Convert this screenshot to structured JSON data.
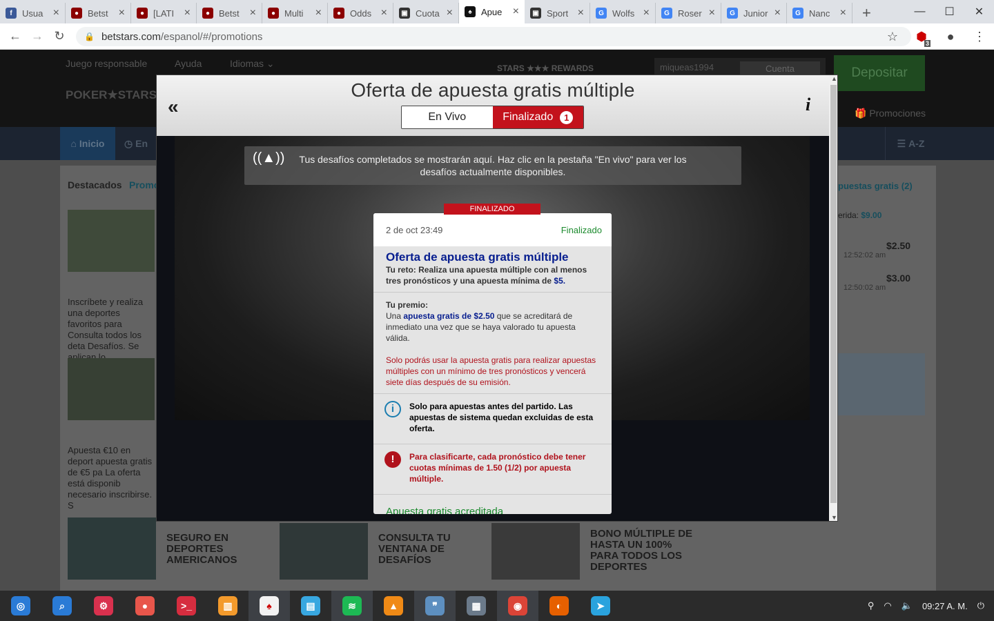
{
  "browser": {
    "tabs": [
      {
        "title": "Usua",
        "icon": "facebook-icon",
        "color": "#3b5998",
        "glyph": "f"
      },
      {
        "title": "Betst",
        "icon": "betstars-icon",
        "color": "#8b0000",
        "glyph": "●"
      },
      {
        "title": "[LATI",
        "icon": "betstars-icon",
        "color": "#8b0000",
        "glyph": "●"
      },
      {
        "title": "Betst",
        "icon": "betstars-icon",
        "color": "#8b0000",
        "glyph": "●"
      },
      {
        "title": "Multi",
        "icon": "betstars-icon",
        "color": "#8b0000",
        "glyph": "●"
      },
      {
        "title": "Odds",
        "icon": "betstars-icon",
        "color": "#8b0000",
        "glyph": "●"
      },
      {
        "title": "Cuota",
        "icon": "chart-icon",
        "color": "#333333",
        "glyph": "▣"
      },
      {
        "title": "Apue",
        "icon": "pokerstars-icon",
        "color": "#111111",
        "glyph": "♠",
        "active": true
      },
      {
        "title": "Sport",
        "icon": "chart-icon",
        "color": "#333333",
        "glyph": "▣"
      },
      {
        "title": "Wolfs",
        "icon": "google-icon",
        "color": "#4285f4",
        "glyph": "G"
      },
      {
        "title": "Roser",
        "icon": "google-icon",
        "color": "#4285f4",
        "glyph": "G"
      },
      {
        "title": "Junior",
        "icon": "google-icon",
        "color": "#4285f4",
        "glyph": "G"
      },
      {
        "title": "Nanc",
        "icon": "google-icon",
        "color": "#4285f4",
        "glyph": "G"
      }
    ],
    "url_host": "betstars.com",
    "url_path": "/espanol/#/promotions",
    "ext_badge": "3"
  },
  "site": {
    "top_links": [
      "Juego responsable",
      "Ayuda",
      "Idiomas ⌄"
    ],
    "logo": "POKER★STARS",
    "rewards": "STARS ★★★ REWARDS",
    "username": "miqueas1994",
    "cuenta": "Cuenta",
    "deposit": "Depositar",
    "promos": "Promociones",
    "nav_inicio": "Inicio",
    "nav_envivo": "En",
    "nav_az": "A-Z",
    "tab_destacados": "Destacados",
    "tab_promos": "Promo",
    "right_tab": "puestas gratis",
    "right_tab_count": "(2)",
    "right_req_label": "erida:",
    "right_req_value": "$9.00",
    "right_items": [
      {
        "value": "$2.50",
        "time": "12:52:02 am"
      },
      {
        "value": "$3.00",
        "time": "12:50:02 am"
      }
    ],
    "left_text1": "Inscríbete y realiza una deportes favoritos para Consulta todos los deta Desafíos. Se aplican lo",
    "left_text2": "Apuesta €10 en deport apuesta gratis de €5 pa La oferta está disponib necesario inscribirse. S",
    "cards": [
      "SEGURO EN DEPORTES AMERICANOS",
      "CONSULTA TU VENTANA DE DESAFÍOS",
      "BONO MÚLTIPLE DE HASTA UN 100% PARA TODOS LOS DEPORTES"
    ]
  },
  "modal": {
    "title": "Oferta de apuesta gratis múltiple",
    "back": "«",
    "info": "i",
    "seg_live": "En Vivo",
    "seg_done": "Finalizado",
    "seg_done_count": "1",
    "notice": "Tus desafíos completados se mostrarán aquí. Haz clic en la pestaña \"En vivo\" para ver los desafíos actualmente disponibles.",
    "ribbon": "FINALIZADO",
    "card": {
      "date": "2 de oct 23:49",
      "status": "Finalizado",
      "heading": "Oferta de apuesta gratis múltiple",
      "challenge_prefix": "Tu reto: Realiza una apuesta múltiple con al menos tres pronósticos y una apuesta mínima de",
      "challenge_amount": "$5.",
      "prize_label": "Tu premio:",
      "prize_pre": "Una",
      "prize_link": "apuesta gratis de $2.50",
      "prize_post": "que se acreditará de inmediato una vez que se haya valorado tu apuesta válida.",
      "warning": "Solo podrás usar la apuesta gratis para realizar apuestas múltiples con un mínimo de tres pronósticos y vencerá siete días después de su emisión.",
      "info_note": "Solo para apuestas antes del partido. Las apuestas de sistema quedan excluidas de esta oferta.",
      "alert_note": "Para clasificarte, cada pronóstico debe tener cuotas mínimas de 1.50 (1/2) por apuesta múltiple.",
      "footer": "Apuesta gratis acreditada"
    }
  },
  "taskbar": {
    "apps": [
      {
        "name": "deepin-launcher-icon",
        "color": "#2a7bd6",
        "glyph": "◎"
      },
      {
        "name": "search-icon",
        "color": "#2a7bd6",
        "glyph": "⌕"
      },
      {
        "name": "settings-icon",
        "color": "#d9314e",
        "glyph": "⚙"
      },
      {
        "name": "screen-recorder-icon",
        "color": "#e8564b",
        "glyph": "●"
      },
      {
        "name": "terminal-icon",
        "color": "#d62d3f",
        "glyph": ">_"
      },
      {
        "name": "archive-icon",
        "color": "#f39a2c",
        "glyph": "▥"
      },
      {
        "name": "cards-game-icon",
        "color": "#f2f2f2",
        "glyph": "♠",
        "active": true
      },
      {
        "name": "app-store-icon",
        "color": "#38a7e0",
        "glyph": "▤"
      },
      {
        "name": "spotify-icon",
        "color": "#1db954",
        "glyph": "≋",
        "active": true
      },
      {
        "name": "vlc-icon",
        "color": "#f08a16",
        "glyph": "▲"
      },
      {
        "name": "notes-icon",
        "color": "#5d8fc0",
        "glyph": "❞",
        "active": true
      },
      {
        "name": "calculator-icon",
        "color": "#6b7a8a",
        "glyph": "▦"
      },
      {
        "name": "chrome-icon",
        "color": "#db4437",
        "glyph": "◉",
        "active": true
      },
      {
        "name": "firefox-icon",
        "color": "#e66000",
        "glyph": "◐"
      },
      {
        "name": "telegram-icon",
        "color": "#2aa3de",
        "glyph": "➤"
      }
    ],
    "clock": "09:27 A. M."
  }
}
